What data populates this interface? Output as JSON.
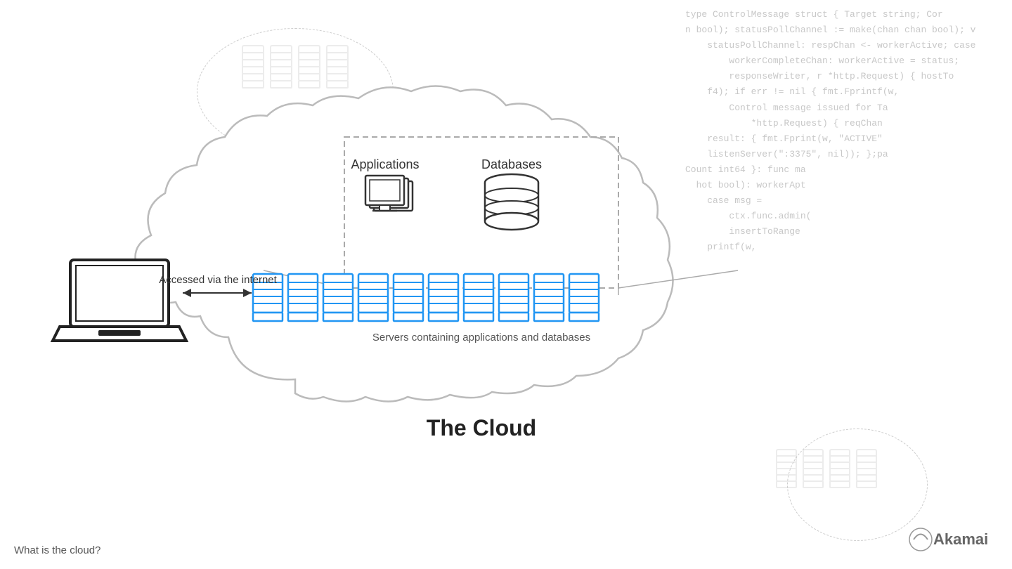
{
  "bg_code": {
    "lines": [
      "type ControlMessage struct { Target string; Cor",
      "n bool); statusPollChannel := make(chan chan bool); v",
      "statusPollChannel: respChan <- workerActive; case",
      "workerCompleteChan: workerActive = status;",
      "responseWriter, r *http.Request) { hostTo",
      "f4); if err != nil { fmt.Fprintf(w,",
      "Control message issued for Ta",
      "*http.Request) { reqChan",
      "result: { fmt.Fprint(w, \"ACTIVE\"",
      "listenServer(\":3375\", nil)); };pa",
      "Count int64 }: func ma",
      "hot bool): workerApt",
      "case msg =",
      "ctx.func.admin(",
      "insertToRange",
      "printf(w,"
    ]
  },
  "diagram": {
    "cloud_title": "The Cloud",
    "accessed_label": "Accessed via the internet",
    "servers_label": "Servers containing applications and databases",
    "applications_label": "Applications",
    "databases_label": "Databases",
    "bottom_page_label": "What is the cloud?"
  },
  "akamai": {
    "logo_text": "Akamai"
  }
}
